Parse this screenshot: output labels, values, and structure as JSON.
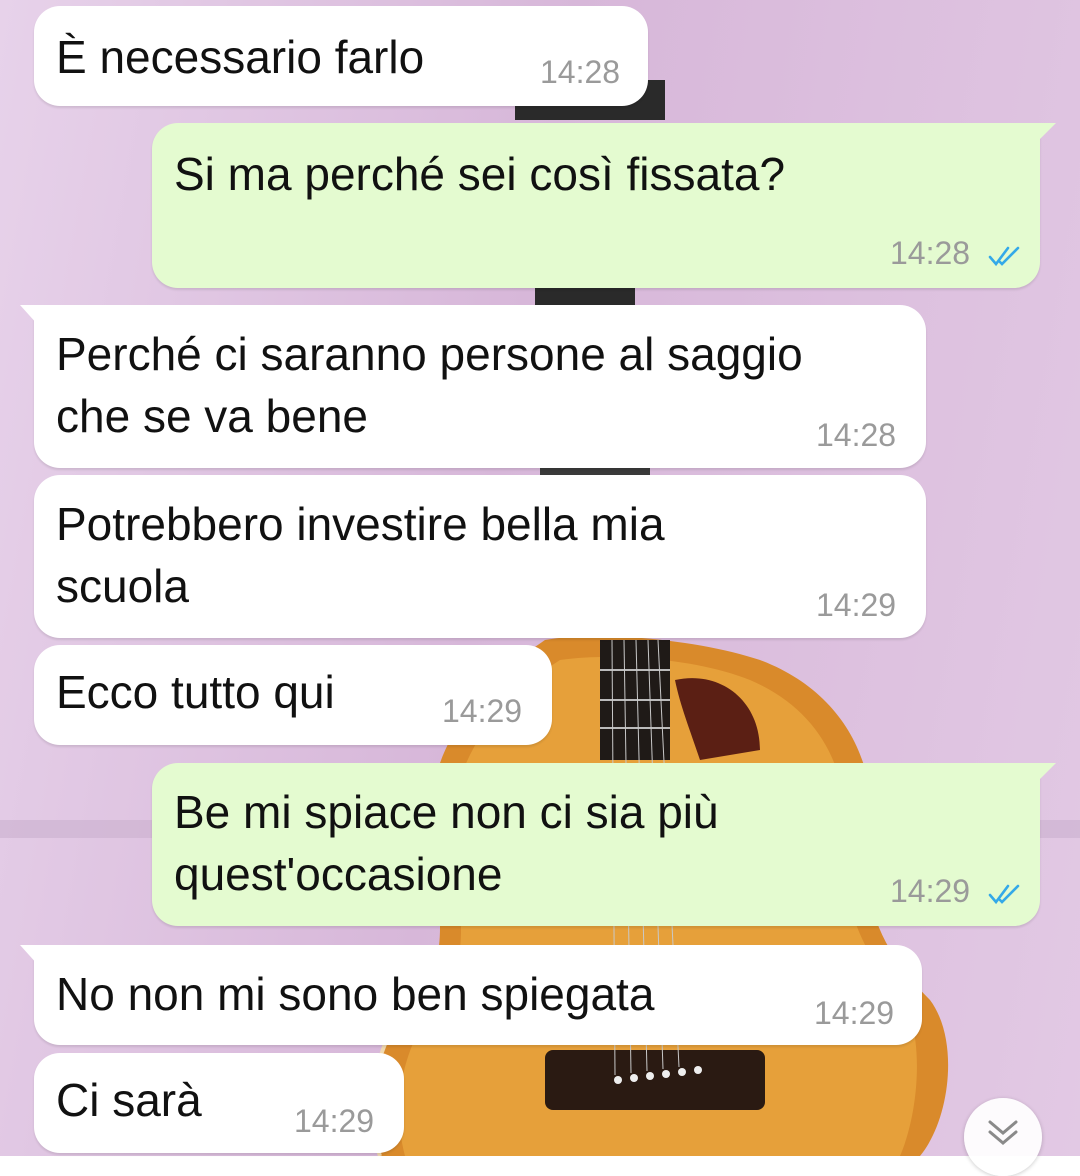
{
  "messages": [
    {
      "text": "È necessario farlo",
      "time": "14:28"
    },
    {
      "text": "Si ma perché sei così fissata?",
      "time": "14:28"
    },
    {
      "text": "Perché ci saranno persone al saggio\nche se va bene",
      "time": "14:28"
    },
    {
      "text": "Potrebbero investire bella mia\nscuola",
      "time": "14:29"
    },
    {
      "text": "Ecco tutto qui",
      "time": "14:29"
    },
    {
      "text": "Be mi spiace non ci sia più\nquest'occasione",
      "time": "14:29"
    },
    {
      "text": "No non mi sono ben spiegata",
      "time": "14:29"
    },
    {
      "text": "Ci sarà",
      "time": "14:29"
    }
  ],
  "icons": {
    "read_receipt": "double-check-icon",
    "scroll_down": "chevron-double-down-icon"
  },
  "colors": {
    "incoming_bubble": "#ffffff",
    "outgoing_bubble": "#e4fbd0",
    "read_ticks": "#34a9e8",
    "timestamp": "#9a9a9a"
  }
}
